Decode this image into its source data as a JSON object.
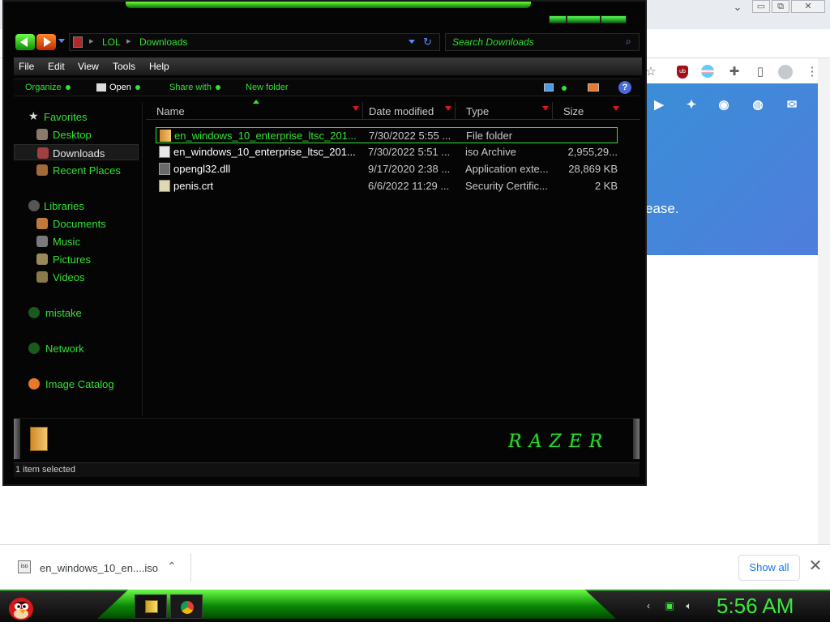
{
  "browser": {
    "minimize": "▭",
    "restore": "⧉",
    "close": "✕",
    "toolbar_icons": [
      "star-icon",
      "ublock-icon",
      "flag-icon",
      "puzzle-icon",
      "sidebar-icon",
      "profile-icon",
      "menu-icon"
    ],
    "hero_text_tail": "ease.",
    "social_icons": [
      "youtube-icon",
      "twitter-icon",
      "github-icon",
      "discord-icon",
      "mail-icon"
    ]
  },
  "downloads": {
    "file_name": "en_windows_10_en....iso",
    "show_all": "Show all",
    "iso_label": "iso",
    "close": "✕",
    "chevron": "⌃"
  },
  "explorer": {
    "path": [
      "LOL",
      "Downloads"
    ],
    "search_placeholder": "Search Downloads",
    "menu": [
      "File",
      "Edit",
      "View",
      "Tools",
      "Help"
    ],
    "commands": {
      "organize": "Organize",
      "open": "Open",
      "share": "Share with",
      "new_folder": "New folder",
      "help": "?"
    },
    "nav": {
      "favorites": "Favorites",
      "desktop": "Desktop",
      "downloads": "Downloads",
      "recent": "Recent Places",
      "libraries": "Libraries",
      "documents": "Documents",
      "music": "Music",
      "pictures": "Pictures",
      "videos": "Videos",
      "mistake": "mistake",
      "network": "Network",
      "image_catalog": "Image Catalog"
    },
    "columns": {
      "name": "Name",
      "date": "Date modified",
      "type": "Type",
      "size": "Size"
    },
    "files": [
      {
        "name": "en_windows_10_enterprise_ltsc_201...",
        "date": "7/30/2022 5:55 ...",
        "type": "File folder",
        "size": "",
        "icon": "folder-icon",
        "selected": true
      },
      {
        "name": "en_windows_10_enterprise_ltsc_201...",
        "date": "7/30/2022 5:51 ...",
        "type": "iso Archive",
        "size": "2,955,29...",
        "icon": "iso-icon",
        "selected": false
      },
      {
        "name": "opengl32.dll",
        "date": "9/17/2020 2:38 ...",
        "type": "Application exte...",
        "size": "28,869 KB",
        "icon": "dll-icon",
        "selected": false
      },
      {
        "name": "penis.crt",
        "date": "6/6/2022 11:29 ...",
        "type": "Security Certific...",
        "size": "2 KB",
        "icon": "certificate-icon",
        "selected": false
      }
    ],
    "branding": "RAZER",
    "status": "1 item selected"
  },
  "taskbar": {
    "clock": "5:56 AM",
    "pinned": [
      "explorer-icon",
      "chrome-icon"
    ]
  },
  "colors": {
    "accent_green": "#35e035",
    "window_bg": "#050505",
    "chrome_blue": "#1a73e8"
  }
}
